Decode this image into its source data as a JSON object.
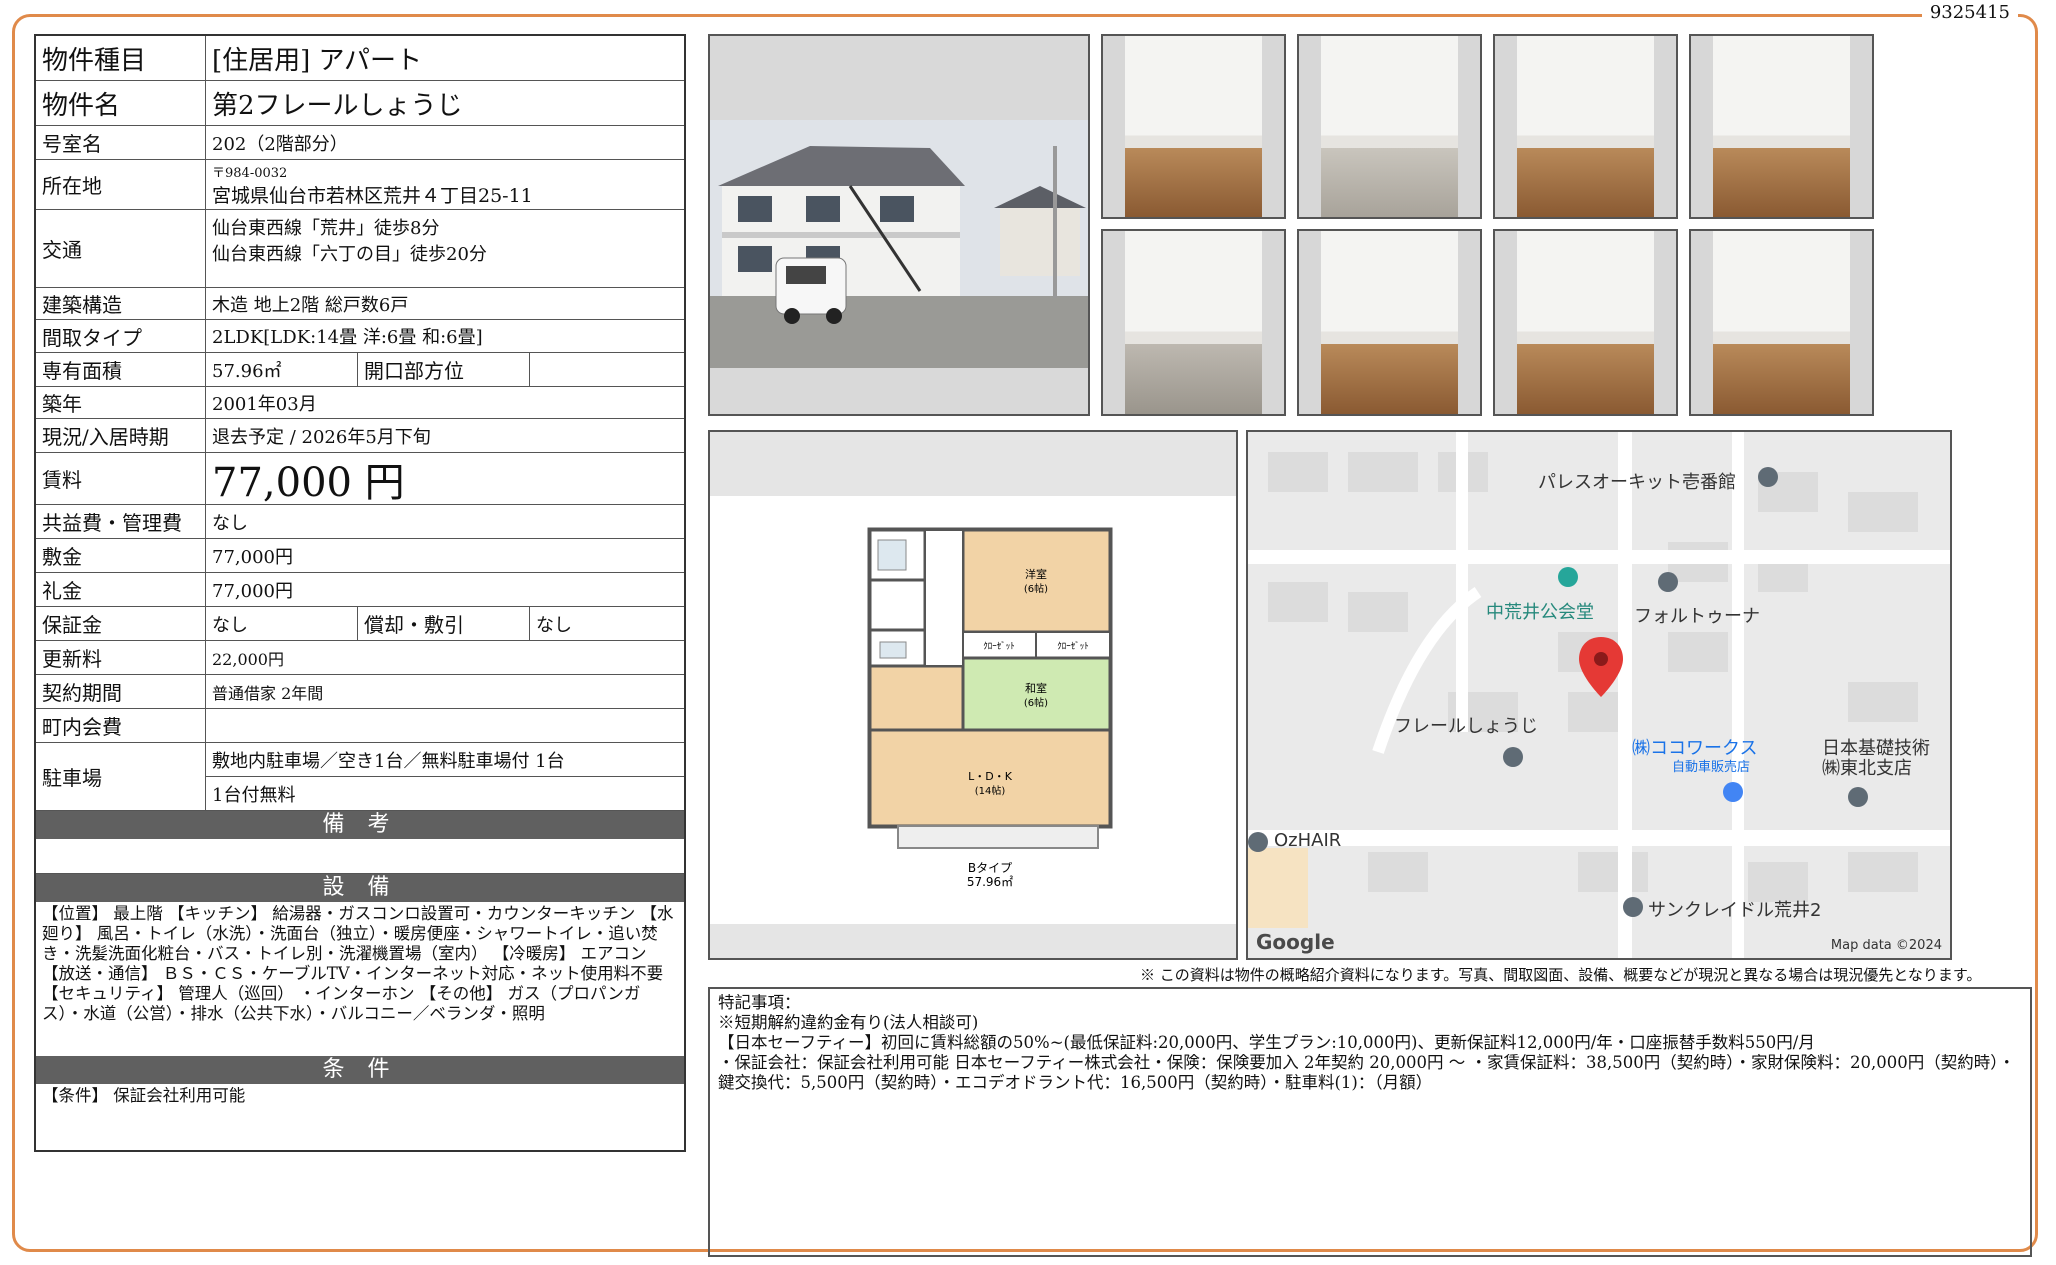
{
  "doc_id": "9325415",
  "property": {
    "type_label": "物件種目",
    "type_value": "[住居用]  アパート",
    "name_label": "物件名",
    "name_value": "第2フレールしょうじ",
    "room_label": "号室名",
    "room_value": "202（2階部分）",
    "address_label": "所在地",
    "postal": "〒984-0032",
    "address": "宮城県仙台市若林区荒井４丁目25-11",
    "access_label": "交通",
    "access_1": "仙台東西線「荒井」徒歩8分",
    "access_2": "仙台東西線「六丁の目」徒歩20分",
    "structure_label": "建築構造",
    "structure_value": "木造  地上2階  総戸数6戸",
    "layout_label": "間取タイプ",
    "layout_value": "2LDK[LDK:14畳  洋:6畳  和:6畳]",
    "area_label": "専有面積",
    "area_value": "57.96㎡",
    "facing_label": "開口部方位",
    "facing_value": "",
    "built_label": "築年",
    "built_value": "2001年03月",
    "status_label": "現況/入居時期",
    "status_value": "退去予定  /  2026年5月下旬",
    "rent_label": "賃料",
    "rent_value": "77,000 円",
    "fee_label": "共益費・管理費",
    "fee_value": "なし",
    "deposit_label": "敷金",
    "deposit_value": "77,000円",
    "key_money_label": "礼金",
    "key_money_value": "77,000円",
    "guarantee_label": "保証金",
    "guarantee_value": "なし",
    "amort_label": "償却・敷引",
    "amort_value": "なし",
    "renewal_label": "更新料",
    "renewal_value": "22,000円",
    "contract_label": "契約期間",
    "contract_value": "普通借家  2年間",
    "town_fee_label": "町内会費",
    "town_fee_value": "",
    "parking_label": "駐車場",
    "parking_1": "敷地内駐車場／空き1台／無料駐車場付  1台",
    "parking_2": "1台付無料"
  },
  "sections": {
    "remarks_title": "備 考",
    "equipment_title": "設 備",
    "equipment_text": "【位置】 最上階 【キッチン】 給湯器・ガスコンロ設置可・カウンターキッチン 【水廻り】 風呂・トイレ（水洗）・洗面台（独立）・暖房便座・シャワートイレ・追い焚き・洗髪洗面化粧台・バス・トイレ別・洗濯機置場（室内） 【冷暖房】 エアコン 【放送・通信】 ＢＳ・ＣＳ・ケーブルTV・インターネット対応・ネット使用料不要 【セキュリティ】 管理人（巡回） ・インターホン 【その他】 ガス（プロパンガス）・水道（公営）・排水（公共下水）・バルコニー／ベランダ・照明",
    "conditions_title": "条 件",
    "conditions_text": "【条件】 保証会社利用可能"
  },
  "floorplan": {
    "room_western": "洋室\n(6帖)",
    "closet1": "ｸﾛｰｾﾞｯﾄ",
    "closet2": "ｸﾛｰｾﾞｯﾄ",
    "room_japanese": "和室\n(6帖)",
    "ldk": "L・D・K\n(14帖)",
    "caption_type": "Bタイプ",
    "caption_area": "57.96㎡"
  },
  "map": {
    "labels": [
      "パレスオーキット壱番館",
      "中荒井公会堂",
      "フォルトゥーナ",
      "フレールしょうじ",
      "㈱ココワークス",
      "自動車販売店",
      "日本基礎技術",
      "㈱東北支店",
      "OzHAIR",
      "サンクレイドル荒井2"
    ],
    "google": "Google",
    "map_data": "Map data ©2024",
    "pin_color": "#e53935"
  },
  "note": "※ この資料は物件の概略紹介資料になります。写真、間取図面、設備、概要などが現況と異なる場合は現況優先となります。",
  "special": {
    "title": "特記事項：",
    "line1": "※短期解約違約金有り(法人相談可)",
    "line2": "【日本セーフティー】初回に賃料総額の50%~(最低保証料:20,000円、学生プラン:10,000円)、更新保証料12,000円/年・口座振替手数料550円/月",
    "line3": "・保証会社：保証会社利用可能 日本セーフティー株式会社・保険：保険要加入 2年契約 20,000円 〜 ・家賃保証料：38,500円（契約時）・家財保険料：20,000円（契約時）・鍵交換代：5,500円（契約時）・エコデオドラント代：16,500円（契約時）・駐車料(1)：（月額）"
  },
  "colors": {
    "frame": "#e08a4a",
    "section_bg": "#606060",
    "wa_room": "#cfeab2",
    "ldk": "#f2d3a6"
  }
}
